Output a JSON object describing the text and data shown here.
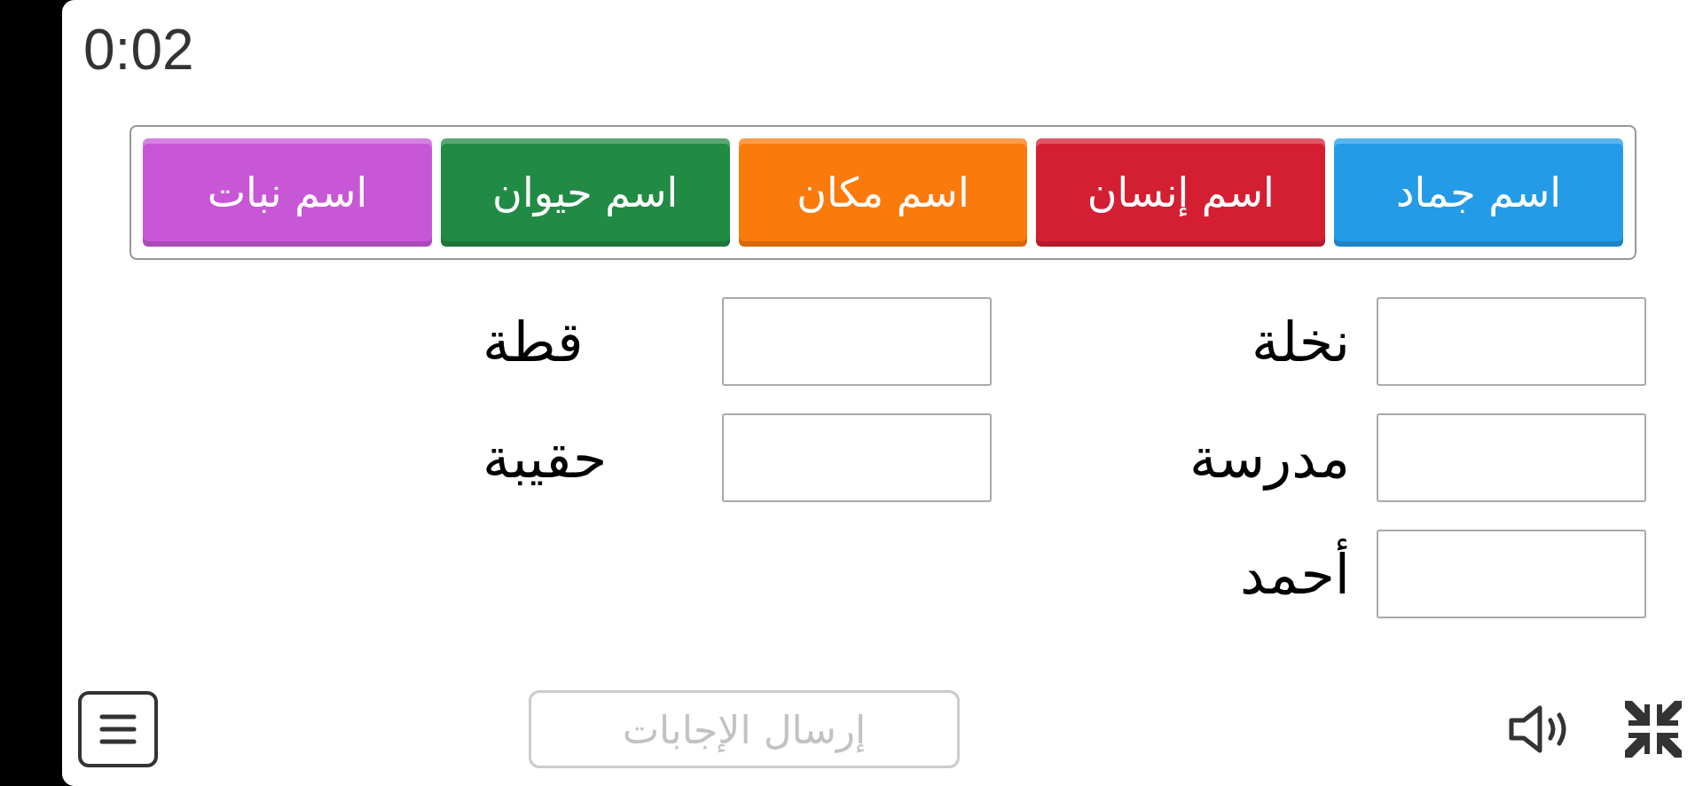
{
  "timer": "0:02",
  "categories": [
    {
      "label": "اسم جماد",
      "color": "#239be6"
    },
    {
      "label": "اسم إنسان",
      "color": "#d41f33"
    },
    {
      "label": "اسم مكان",
      "color": "#fb7a0c"
    },
    {
      "label": "اسم حيوان",
      "color": "#218a45"
    },
    {
      "label": "اسم نبات",
      "color": "#c857d8"
    }
  ],
  "answer_columns": [
    [
      {
        "word": "نخلة"
      },
      {
        "word": "مدرسة"
      },
      {
        "word": "أحمد"
      }
    ],
    [
      {
        "word": "قطة"
      },
      {
        "word": "حقيبة"
      }
    ]
  ],
  "submit_button": {
    "label": "إرسال الإجابات",
    "disabled": true
  }
}
